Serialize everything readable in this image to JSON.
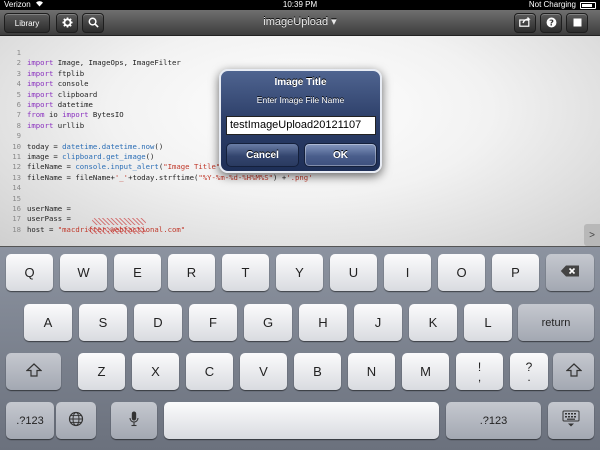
{
  "status_bar": {
    "carrier": "Verizon",
    "time": "10:39 PM",
    "battery_text": "Not Charging"
  },
  "toolbar": {
    "library_label": "Library",
    "title": "imageUpload ▾"
  },
  "editor": {
    "lines": [
      {
        "n": "1",
        "code": ""
      },
      {
        "n": "2",
        "code": "import Image, ImageOps, ImageFilter"
      },
      {
        "n": "3",
        "code": "import ftplib"
      },
      {
        "n": "4",
        "code": "import console"
      },
      {
        "n": "5",
        "code": "import clipboard"
      },
      {
        "n": "6",
        "code": "import datetime"
      },
      {
        "n": "7",
        "code": "from io import BytesIO"
      },
      {
        "n": "8",
        "code": "import urllib"
      },
      {
        "n": "9",
        "code": ""
      },
      {
        "n": "10",
        "code": "today = datetime.datetime.now()"
      },
      {
        "n": "11",
        "code": "image = clipboard.get_image()"
      },
      {
        "n": "12",
        "code": "fileName = console.input_alert(\"Image Title\", \"Enter Image File Name\")"
      },
      {
        "n": "13",
        "code": "fileName = fileName+'_'+today.strftime(\"%Y-%m-%d-%H%M%S\") +'.png'"
      },
      {
        "n": "14",
        "code": ""
      },
      {
        "n": "15",
        "code": ""
      },
      {
        "n": "16",
        "code": "userName = "
      },
      {
        "n": "17",
        "code": "userPass = "
      },
      {
        "n": "18",
        "code": "host = \"macdrifter.webfactional.com\""
      }
    ]
  },
  "alert": {
    "title": "Image Title",
    "message": "Enter Image File Name",
    "input_value": "testImageUpload20121107",
    "cancel_label": "Cancel",
    "ok_label": "OK"
  },
  "keyboard": {
    "row1": [
      "Q",
      "W",
      "E",
      "R",
      "T",
      "Y",
      "U",
      "I",
      "O",
      "P"
    ],
    "row2": [
      "A",
      "S",
      "D",
      "F",
      "G",
      "H",
      "J",
      "K",
      "L"
    ],
    "return_label": "return",
    "row3": [
      "Z",
      "X",
      "C",
      "V",
      "B",
      "N",
      "M"
    ],
    "punct1_top": "!",
    "punct1_bottom": ",",
    "punct2_top": "?",
    "punct2_bottom": ".",
    "numbers_label": ".?123",
    "numbers_label_right": ".?123"
  },
  "colors": {
    "keyword": "#8a2fbf",
    "function": "#2a6db5",
    "string": "#c0392b",
    "alert_blue": "#2c3e68"
  }
}
